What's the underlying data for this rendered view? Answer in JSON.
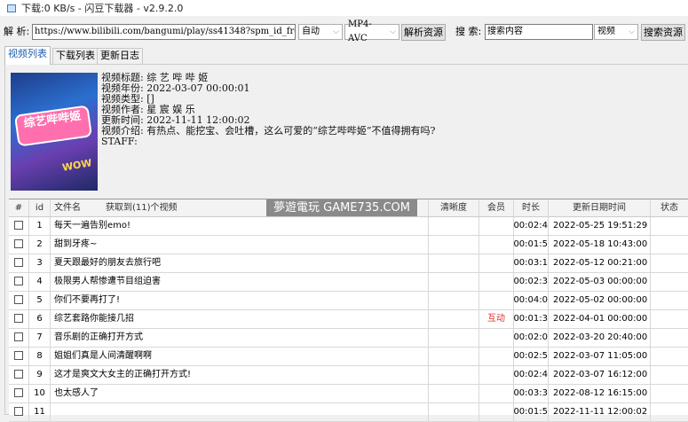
{
  "window": {
    "title": "下载:0 KB/s - 闪豆下载器 - v2.9.2.0"
  },
  "toolbar": {
    "parse_label": "解 析:",
    "url_value": "https://www.bilibili.com/bangumi/play/ss41348?spm_id_fro",
    "mode_select": "自动",
    "format_select": "MP4-AVC",
    "parse_button": "解析资源",
    "search_label": "搜 索:",
    "search_value": "搜索内容",
    "search_type_select": "视频",
    "search_button": "搜索资源"
  },
  "tabs": [
    {
      "label": "视频列表",
      "active": true
    },
    {
      "label": "下载列表"
    },
    {
      "label": "更新日志"
    }
  ],
  "thumbnail": {
    "logo_text": "综艺哔哔姬",
    "badge": "WOW"
  },
  "info": {
    "title": "视频标题: 综 艺 哔 哔 姬",
    "year": "视频年份: 2022-03-07 00:00:01",
    "type": "视频类型: []",
    "author": "视频作者: 星 宸 娱 乐",
    "updated": "更新时间: 2022-11-11 12:00:02",
    "intro": "视频介绍: 有热点、能挖宝、会吐槽，这么可爱的“综艺哔哔姬”不值得拥有吗?",
    "staff": "STAFF:"
  },
  "table": {
    "headers": {
      "check": "#",
      "id": "id",
      "name": "文件名",
      "count": "获取到(11)个视频",
      "quality": "清晰度",
      "vip": "会员",
      "duration": "时长",
      "date": "更新日期时间",
      "status": "状态"
    },
    "rows": [
      {
        "id": "1",
        "name": "每天一遍告别emo!",
        "vip": "",
        "duration": "00:02:4",
        "date": "2022-05-25 19:51:29"
      },
      {
        "id": "2",
        "name": "甜到牙疼~",
        "vip": "",
        "duration": "00:01:5",
        "date": "2022-05-18 10:43:00"
      },
      {
        "id": "3",
        "name": "夏天跟最好的朋友去旅行吧",
        "vip": "",
        "duration": "00:03:1",
        "date": "2022-05-12 00:21:00"
      },
      {
        "id": "4",
        "name": "极限男人帮惨遭节目组迫害",
        "vip": "",
        "duration": "00:02:3",
        "date": "2022-05-03 00:00:00"
      },
      {
        "id": "5",
        "name": "你们不要再打了!",
        "vip": "",
        "duration": "00:04:0",
        "date": "2022-05-02 00:00:00"
      },
      {
        "id": "6",
        "name": "综艺套路你能接几招",
        "vip": "互动",
        "duration": "00:01:3",
        "date": "2022-04-01 00:00:00"
      },
      {
        "id": "7",
        "name": "音乐剧的正确打开方式",
        "vip": "",
        "duration": "00:02:0",
        "date": "2022-03-20 20:40:00"
      },
      {
        "id": "8",
        "name": "姐姐们真是人间清醒啊啊",
        "vip": "",
        "duration": "00:02:5",
        "date": "2022-03-07 11:05:00"
      },
      {
        "id": "9",
        "name": "这才是爽文大女主的正确打开方式!",
        "vip": "",
        "duration": "00:02:4",
        "date": "2022-03-07 16:12:00"
      },
      {
        "id": "10",
        "name": "也太感人了",
        "vip": "",
        "duration": "00:03:3",
        "date": "2022-08-12 16:15:00"
      },
      {
        "id": "11",
        "name": "",
        "vip": "",
        "duration": "00:01:5",
        "date": "2022-11-11 12:00:02"
      }
    ]
  },
  "watermark": "夢遊電玩 GAME735.COM"
}
